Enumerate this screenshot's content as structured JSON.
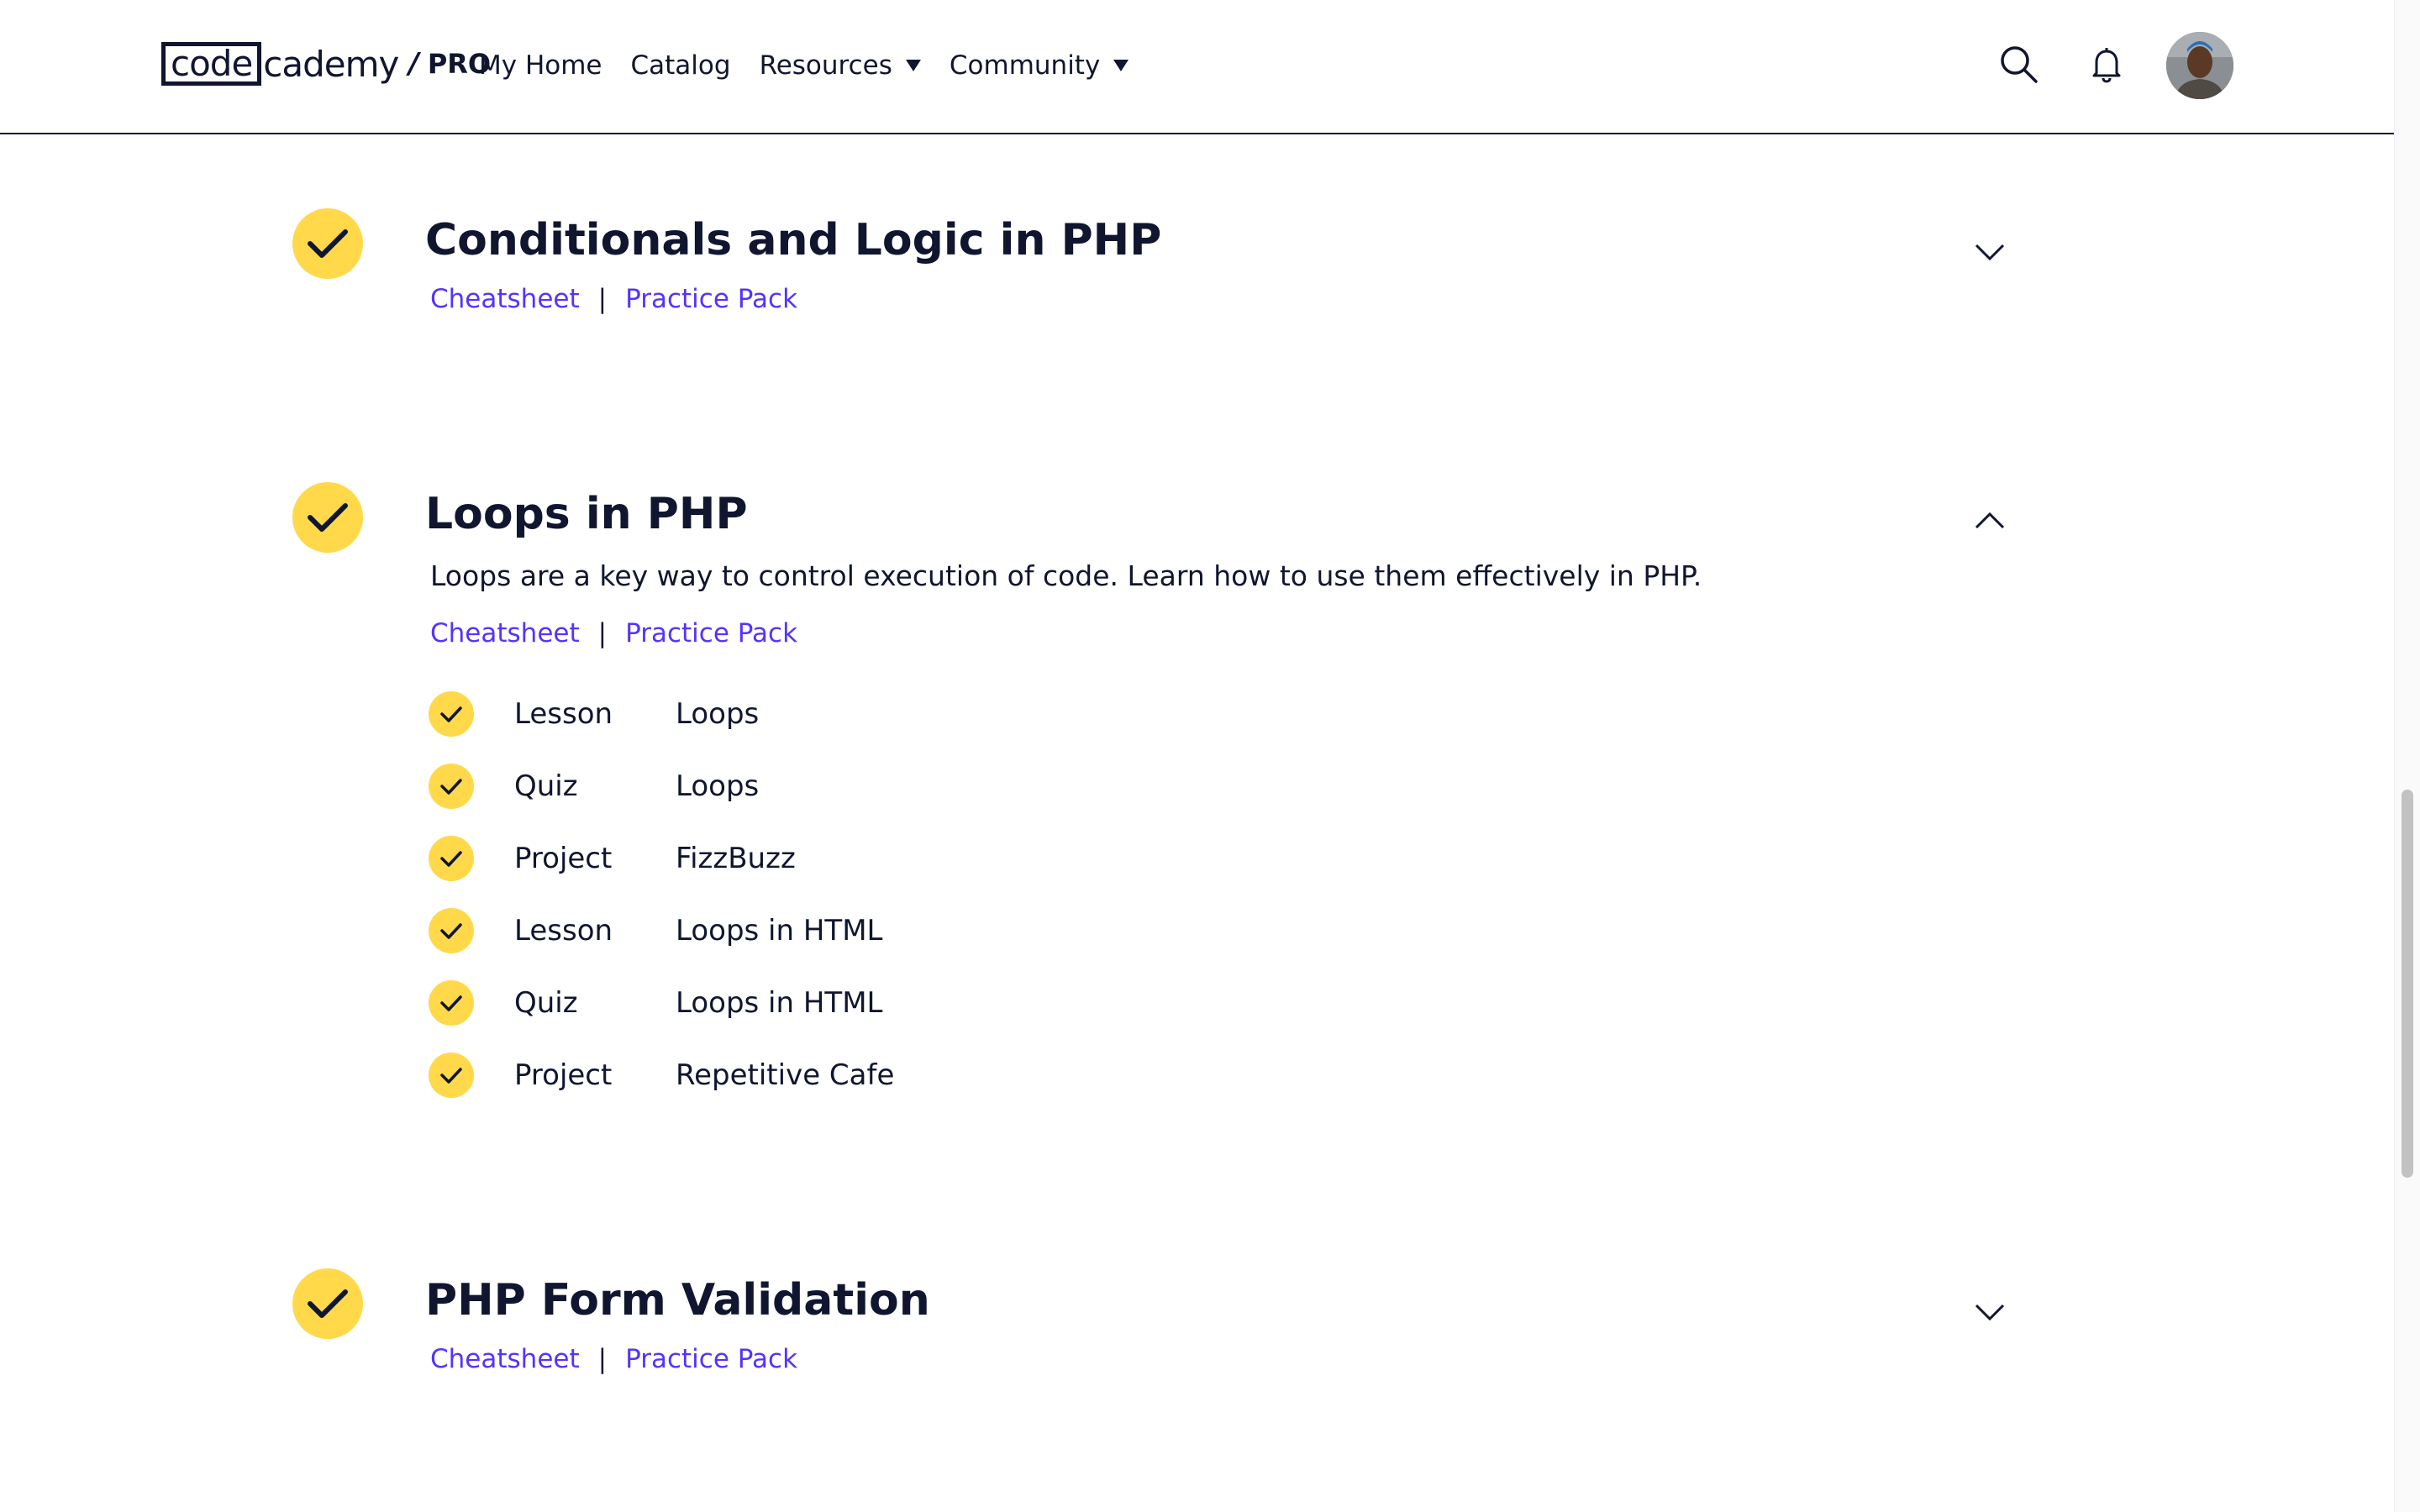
{
  "header": {
    "logo": {
      "code": "code",
      "cademy": "cademy",
      "separator": "/",
      "pro": "PRO"
    },
    "nav": [
      {
        "label": "My Home"
      },
      {
        "label": "Catalog"
      },
      {
        "label": "Resources",
        "dropdown": true
      },
      {
        "label": "Community",
        "dropdown": true
      }
    ],
    "icons": [
      "search-icon",
      "bell-icon",
      "avatar"
    ]
  },
  "modules": [
    {
      "title": "Conditionals and Logic in PHP",
      "completed": true,
      "expanded": false,
      "links": {
        "cheatsheet": "Cheatsheet",
        "separator": "|",
        "practice": "Practice Pack"
      }
    },
    {
      "title": "Loops in PHP",
      "completed": true,
      "expanded": true,
      "description": "Loops are a key way to control execution of code. Learn how to use them effectively in PHP.",
      "links": {
        "cheatsheet": "Cheatsheet",
        "separator": "|",
        "practice": "Practice Pack"
      },
      "items": [
        {
          "type": "Lesson",
          "name": "Loops",
          "completed": true
        },
        {
          "type": "Quiz",
          "name": "Loops",
          "completed": true
        },
        {
          "type": "Project",
          "name": "FizzBuzz",
          "completed": true
        },
        {
          "type": "Lesson",
          "name": "Loops in HTML",
          "completed": true
        },
        {
          "type": "Quiz",
          "name": "Loops in HTML",
          "completed": true
        },
        {
          "type": "Project",
          "name": "Repetitive Cafe",
          "completed": true
        }
      ]
    },
    {
      "title": "PHP Form Validation",
      "completed": true,
      "expanded": false,
      "links": {
        "cheatsheet": "Cheatsheet",
        "separator": "|",
        "practice": "Practice Pack"
      }
    }
  ],
  "colors": {
    "accent_yellow": "#ffd94a",
    "link_purple": "#5533ff",
    "text_navy": "#10162f"
  }
}
